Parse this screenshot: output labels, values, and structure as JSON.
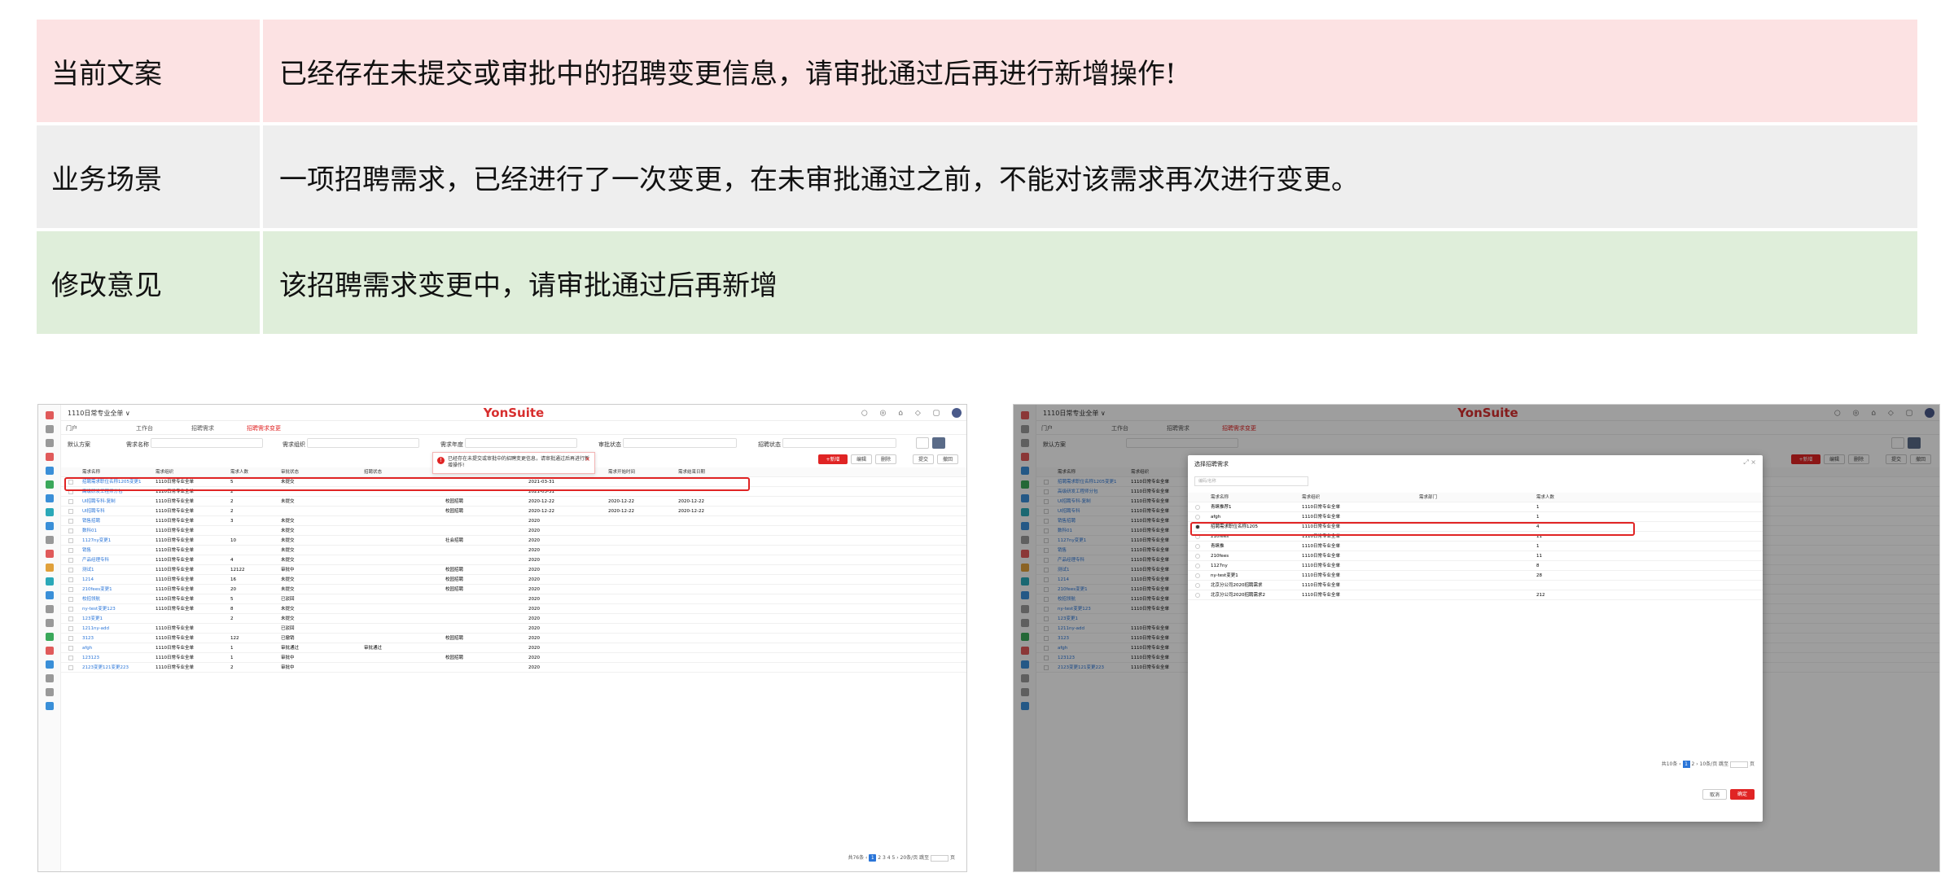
{
  "review_table": {
    "rows": [
      {
        "key": "当前文案",
        "value": "已经存在未提交或审批中的招聘变更信息，请审批通过后再进行新增操作!"
      },
      {
        "key": "业务场景",
        "value": "一项招聘需求，已经进行了一次变更，在未审批通过之前，不能对该需求再次进行变更。"
      },
      {
        "key": "修改意见",
        "value": "该招聘需求变更中，请审批通过后再新增"
      }
    ]
  },
  "colors": {
    "brand_red": "#e02424",
    "link_blue": "#2a75d8",
    "row_pink": "#fce2e3",
    "row_gray": "#eeeeee",
    "row_green": "#dfeeda"
  },
  "app": {
    "org": "1110日常专业全单 ∨",
    "brand": "YonSuite",
    "tabs": [
      "门户",
      "工作台",
      "招聘需求",
      "招聘需求变更"
    ],
    "scheme": "默认方案",
    "filters": [
      "需求名称",
      "需求组织",
      "需求年度",
      "审批状态",
      "招聘状态"
    ],
    "buttons": [
      "+新增",
      "编辑",
      "删除",
      "提交",
      "撤回"
    ]
  },
  "screenshot1": {
    "toast": "已经存在未提交或审批中的招聘变更信息，请审批通过后再进行新增操作!",
    "columns": [
      "需求名称",
      "需求组织",
      "需求人数",
      "审批状态",
      "招聘状态",
      "招聘来源",
      "需求年度",
      "需求开始时间",
      "需求结束日期"
    ],
    "rows": [
      [
        "招聘需求职位名称1205变更1",
        "1110日常专业全单",
        "5",
        "未提交",
        "",
        "",
        "2021-03-31",
        "",
        ""
      ],
      [
        "高级研发工程师分包",
        "1110日常专业全单",
        "2",
        "",
        "",
        "",
        "2021-03-31",
        "",
        ""
      ],
      [
        "UI招聘专科-复制",
        "1110日常专业全单",
        "2",
        "未提交",
        "",
        "校园招聘",
        "2020-12-22",
        "2020-12-22",
        "2020-12-22"
      ],
      [
        "UI招聘专科",
        "1110日常专业全单",
        "2",
        "",
        "",
        "校园招聘",
        "2020-12-22",
        "2020-12-22",
        "2020-12-22"
      ],
      [
        "销售招聘",
        "1110日常专业全单",
        "3",
        "未提交",
        "",
        "",
        "2020",
        "",
        ""
      ],
      [
        "数科01",
        "1110日常专业全单",
        "",
        "未提交",
        "",
        "",
        "2020",
        "",
        ""
      ],
      [
        "1127ny变更1",
        "1110日常专业全单",
        "10",
        "未提交",
        "",
        "社会招聘",
        "2020",
        "",
        ""
      ],
      [
        "销售",
        "1110日常专业全单",
        "",
        "未提交",
        "",
        "",
        "2020",
        "",
        ""
      ],
      [
        "产品经理专科",
        "1110日常专业全单",
        "4",
        "未提交",
        "",
        "",
        "2020",
        "",
        ""
      ],
      [
        "测试1",
        "1110日常专业全单",
        "12122",
        "审批中",
        "",
        "校园招聘",
        "2020",
        "",
        ""
      ],
      [
        "1214",
        "1110日常专业全单",
        "16",
        "未提交",
        "",
        "校园招聘",
        "2020",
        "",
        ""
      ],
      [
        "210fees变更1",
        "1110日常专业全单",
        "20",
        "未提交",
        "",
        "校园招聘",
        "2020",
        "",
        ""
      ],
      [
        "校招领航",
        "1110日常专业全单",
        "5",
        "已驳回",
        "",
        "",
        "2020",
        "",
        ""
      ],
      [
        "ny-test变更123",
        "1110日常专业全单",
        "8",
        "未提交",
        "",
        "",
        "2020",
        "",
        ""
      ],
      [
        "123变更1",
        "",
        "2",
        "未提交",
        "",
        "",
        "2020",
        "",
        ""
      ],
      [
        "1211ny-add",
        "1110日常专业全单",
        "",
        "已驳回",
        "",
        "",
        "2020",
        "",
        ""
      ],
      [
        "3123",
        "1110日常专业全单",
        "122",
        "已撤销",
        "",
        "校园招聘",
        "2020",
        "",
        ""
      ],
      [
        "afgh",
        "1110日常专业全单",
        "1",
        "审批通过",
        "审批通过",
        "",
        "2020",
        "",
        ""
      ],
      [
        "123123",
        "1110日常专业全单",
        "1",
        "审批中",
        "",
        "校园招聘",
        "2020",
        "",
        ""
      ],
      [
        "2123变更121变更223",
        "1110日常专业全单",
        "2",
        "审批中",
        "",
        "",
        "2020",
        "",
        ""
      ]
    ],
    "pager": {
      "total": "共76条",
      "pages": [
        "1",
        "2",
        "3",
        "4",
        "5"
      ],
      "size": "20条/页",
      "goto": "跳至",
      "unit": "页"
    }
  },
  "screenshot2": {
    "modal_title": "选择招聘需求",
    "search_placeholder": "编码/名称",
    "columns": [
      "需求名称",
      "需求组织",
      "需求部门",
      "需求人数"
    ],
    "rows": [
      [
        "青睐推荐1",
        "1110日常专业全单",
        "",
        "1"
      ],
      [
        "afgh",
        "1110日常专业全单",
        "",
        "1"
      ],
      [
        "招聘需求职位名称1205",
        "1110日常专业全单",
        "",
        "4"
      ],
      [
        "210fees",
        "1110日常专业全单",
        "",
        "11"
      ],
      [
        "青睐推",
        "1110日常专业全单",
        "",
        "1"
      ],
      [
        "210fees",
        "1110日常专业全单",
        "",
        "11"
      ],
      [
        "1127ny",
        "1110日常专业全单",
        "",
        "8"
      ],
      [
        "ny-test变更1",
        "1110日常专业全单",
        "",
        "28"
      ],
      [
        "北京分公司2020招聘需求",
        "1110日常专业全单",
        "",
        ""
      ],
      [
        "北京分公司2020招聘需求2",
        "1110日常专业全单",
        "",
        "212"
      ]
    ],
    "pager": {
      "total": "共10条",
      "pages": [
        "1",
        "2"
      ],
      "size": "10条/页",
      "goto": "跳至",
      "unit": "页"
    },
    "cancel": "取消",
    "confirm": "确定"
  }
}
